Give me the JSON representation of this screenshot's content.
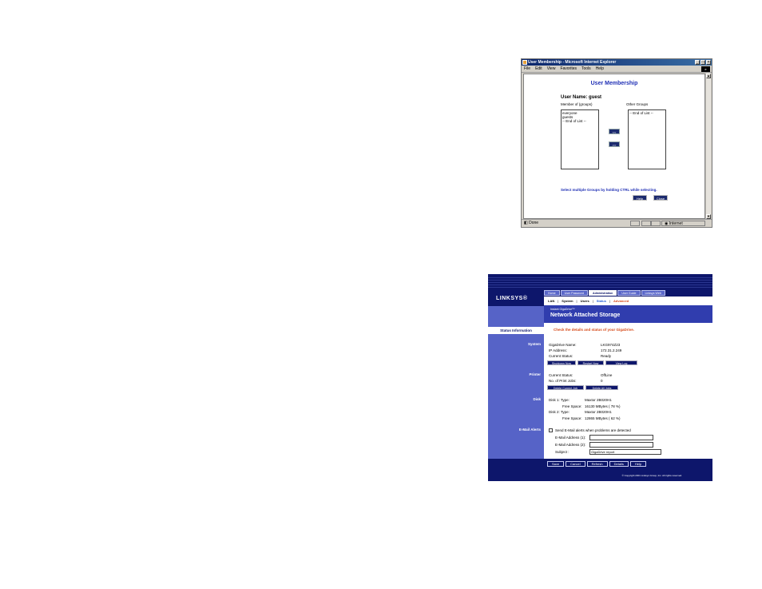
{
  "ie_window": {
    "title": "User Membership - Microsoft Internet Explorer",
    "menu": [
      "File",
      "Edit",
      "View",
      "Favorites",
      "Tools",
      "Help"
    ],
    "status_left": "Done",
    "status_zone": "Internet",
    "page": {
      "title": "User Membership",
      "user_name_label": "User Name:",
      "user_name_value": "guest",
      "member_of_label": "Member of (groups)",
      "other_groups_label": "Other Groups",
      "member_of_items": [
        "everyone",
        "guests",
        "-- End of List --"
      ],
      "other_groups_items": [
        "-- End of List --"
      ],
      "add_button": "<<",
      "remove_button": ">>",
      "hint": "Select multiple Groups by holding CTRL while selecting.",
      "help_button": "Help",
      "close_button": "Close"
    }
  },
  "nas_window": {
    "logo": "LINKSYS®",
    "tabs": [
      "Home",
      "User Password",
      "Administration",
      "User Guide",
      "Linksys Web"
    ],
    "active_tab": "Administration",
    "subnav": [
      "LAN",
      "System",
      "Users",
      "Status",
      "Advanced"
    ],
    "product_small": "Instant GigaDrive™",
    "product_big": "Network Attached Storage",
    "section_tab": "Status Information",
    "heading": "Check the details and status of your GigaDrive.",
    "system": {
      "label": "System",
      "gigadrive_name_label": "GigaDrive Name:",
      "gigadrive_name_value": "LKG974Z23",
      "ip_label": "IP Address:",
      "ip_value": "172.31.2.249",
      "status_label": "Current Status:",
      "status_value": "Ready",
      "buttons": [
        "Shutdown Now",
        "Restart Now",
        "View Log"
      ]
    },
    "printer": {
      "label": "Printer",
      "status_label": "Current Status:",
      "status_value": "OffLine",
      "jobs_label": "No. of Print Jobs:",
      "jobs_value": "0",
      "buttons": [
        "Delete Current Job",
        "Delete All Jobs"
      ]
    },
    "disk": {
      "label": "Disk",
      "disk1_type_label": "Disk 1: Type:",
      "disk1_type_value": "Maxtor 2B020H1",
      "disk1_free_label": "Free Space:",
      "disk1_free_value": "16130 MBytes ( 78 %)",
      "disk2_type_label": "Disk 2: Type:",
      "disk2_type_value": "Maxtor 2B020H1",
      "disk2_free_label": "Free Space:",
      "disk2_free_value": "12865 MBytes ( 62 %)"
    },
    "email": {
      "label": "E-Mail Alerts",
      "checkbox_label": "Send E-Mail alerts when problems are detected",
      "addr1_label": "E-Mail Address (1):",
      "addr1_value": "",
      "addr2_label": "E-Mail Address (2):",
      "addr2_value": "",
      "subject_label": "Subject :",
      "subject_value": "GigaDrive report"
    },
    "footer_buttons": [
      "Save",
      "Cancel",
      "Refresh",
      "Details",
      "Help"
    ],
    "copyright": "© Copyright 2001 Linksys Group, Inc. All rights reserved."
  }
}
